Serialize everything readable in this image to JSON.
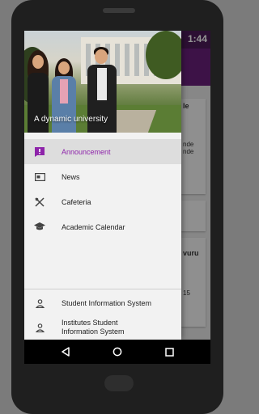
{
  "status_bar": {
    "time": "1:44"
  },
  "drawer": {
    "header_caption": "A dynamic university",
    "menu_items": [
      {
        "label": "Announcement",
        "icon": "announcement-icon",
        "active": true
      },
      {
        "label": "News",
        "icon": "news-icon"
      },
      {
        "label": "Cafeteria",
        "icon": "cutlery-icon"
      },
      {
        "label": "Academic Calendar",
        "icon": "graduation-cap-icon"
      }
    ],
    "bottom_items": [
      {
        "label": "Student Information System",
        "icon": "person-icon"
      },
      {
        "label": "Institutes Student Information System",
        "icon": "person-icon"
      }
    ]
  },
  "background": {
    "card1": {
      "title": "le",
      "line1": "nde",
      "line2": "nde"
    },
    "card2": {
      "title": "vuru",
      "line1": "15"
    }
  },
  "colors": {
    "accent": "#8e24aa",
    "appbar": "#6a1f7a",
    "statusbar": "#4d1a58"
  },
  "nav": {
    "back": "back-icon",
    "home": "home-icon",
    "recents": "recents-icon"
  }
}
